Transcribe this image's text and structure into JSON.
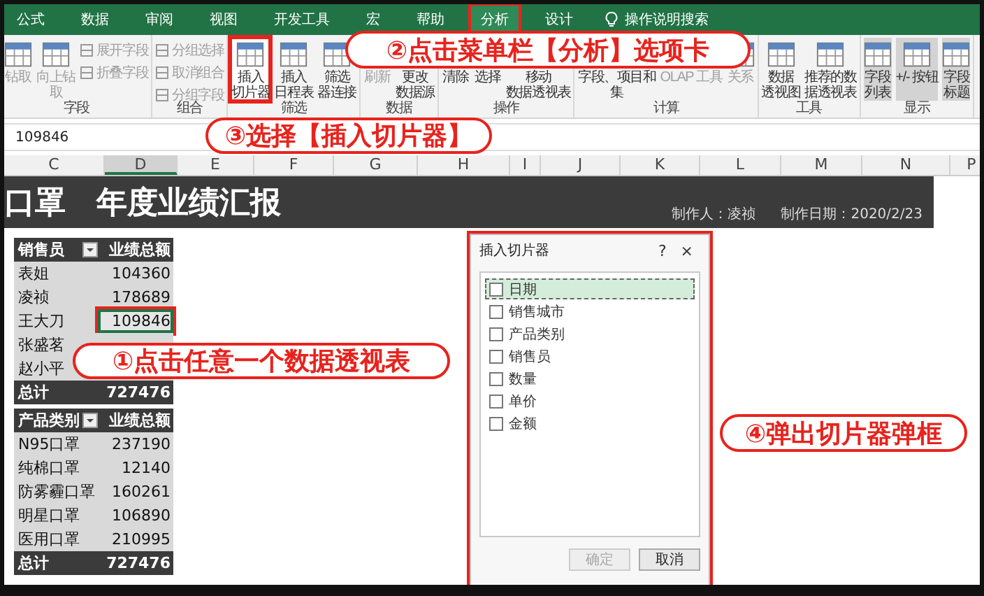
{
  "tabs": [
    {
      "label": "公式",
      "selected": false
    },
    {
      "label": "数据",
      "selected": false
    },
    {
      "label": "审阅",
      "selected": false
    },
    {
      "label": "视图",
      "selected": false
    },
    {
      "label": "开发工具",
      "selected": false
    },
    {
      "label": "宏",
      "selected": false
    },
    {
      "label": "帮助",
      "selected": false
    },
    {
      "label": "分析",
      "selected": true
    },
    {
      "label": "设计",
      "selected": false
    }
  ],
  "tell_me": "操作说明搜索",
  "ribbon_groups": [
    {
      "label": "字段",
      "large": [
        {
          "lines": [
            "钻取"
          ],
          "disabled": true,
          "selected": false,
          "highlighted": false
        },
        {
          "lines": [
            "向上钻",
            "取"
          ],
          "disabled": true,
          "selected": false,
          "highlighted": false
        }
      ],
      "small": [
        {
          "label": "展开字段",
          "disabled": true
        },
        {
          "label": "折叠字段",
          "disabled": true
        }
      ]
    },
    {
      "label": "组合",
      "small": [
        {
          "label": "分组选择",
          "disabled": true
        },
        {
          "label": "取消组合",
          "disabled": true
        },
        {
          "label": "分组字段",
          "disabled": true
        }
      ]
    },
    {
      "label": "筛选",
      "large": [
        {
          "lines": [
            "插入",
            "切片器"
          ],
          "disabled": false,
          "selected": false,
          "highlighted": true
        },
        {
          "lines": [
            "插入",
            "日程表"
          ],
          "disabled": false,
          "selected": false,
          "highlighted": false
        },
        {
          "lines": [
            "筛选",
            "器连接"
          ],
          "disabled": false,
          "selected": false,
          "highlighted": false
        }
      ]
    },
    {
      "label": "数据",
      "large": [
        {
          "lines": [
            "刷新"
          ],
          "disabled": true,
          "selected": false,
          "highlighted": false
        },
        {
          "lines": [
            "更改",
            "数据源"
          ],
          "disabled": false,
          "selected": false,
          "highlighted": false
        }
      ]
    },
    {
      "label": "操作",
      "large": [
        {
          "lines": [
            "清除"
          ],
          "disabled": false,
          "selected": false,
          "highlighted": false
        },
        {
          "lines": [
            "选择"
          ],
          "disabled": false,
          "selected": false,
          "highlighted": false
        },
        {
          "lines": [
            "移动",
            "数据透视表"
          ],
          "disabled": false,
          "selected": false,
          "highlighted": false
        }
      ]
    },
    {
      "label": "计算",
      "large": [
        {
          "lines": [
            "字段、项目和",
            "集"
          ],
          "disabled": false,
          "selected": false,
          "highlighted": false
        },
        {
          "lines": [
            "OLAP 工具"
          ],
          "disabled": true,
          "selected": false,
          "highlighted": false
        },
        {
          "lines": [
            "关系"
          ],
          "disabled": true,
          "selected": false,
          "highlighted": false
        }
      ]
    },
    {
      "label": "工具",
      "large": [
        {
          "lines": [
            "数据",
            "透视图"
          ],
          "disabled": false,
          "selected": false,
          "highlighted": false
        },
        {
          "lines": [
            "推荐的数",
            "据透视表"
          ],
          "disabled": false,
          "selected": false,
          "highlighted": false
        }
      ]
    },
    {
      "label": "显示",
      "large": [
        {
          "lines": [
            "字段",
            "列表"
          ],
          "disabled": false,
          "selected": true,
          "highlighted": false
        },
        {
          "lines": [
            "+/- 按钮"
          ],
          "disabled": false,
          "selected": true,
          "highlighted": false
        },
        {
          "lines": [
            "字段",
            "标题"
          ],
          "disabled": false,
          "selected": true,
          "highlighted": false
        }
      ]
    }
  ],
  "formula_bar": {
    "value": "109846"
  },
  "columns": [
    {
      "label": "C",
      "selected": false
    },
    {
      "label": "D",
      "selected": true
    },
    {
      "label": "E",
      "selected": false
    },
    {
      "label": "F",
      "selected": false
    },
    {
      "label": "G",
      "selected": false
    },
    {
      "label": "H",
      "selected": false
    },
    {
      "label": "I",
      "selected": false
    },
    {
      "label": "J",
      "selected": false
    },
    {
      "label": "K",
      "selected": false
    },
    {
      "label": "L",
      "selected": false
    },
    {
      "label": "M",
      "selected": false
    },
    {
      "label": "N",
      "selected": false
    },
    {
      "label": "P",
      "selected": false
    }
  ],
  "report": {
    "title": "口罩　年度业绩汇报",
    "author": "制作人：凌祯",
    "date": "制作日期：2020/2/23"
  },
  "pivot_tables": [
    {
      "row_header": "销售员",
      "value_header": "业绩总额",
      "rows": [
        {
          "label": "表姐",
          "value": "104360",
          "selected": false
        },
        {
          "label": "凌祯",
          "value": "178689",
          "selected": false
        },
        {
          "label": "王大刀",
          "value": "109846",
          "selected": true
        },
        {
          "label": "张盛茗",
          "selected": false
        },
        {
          "label": "赵小平",
          "selected": false
        }
      ],
      "total_label": "总计",
      "total": "727476"
    },
    {
      "row_header": "产品类别",
      "value_header": "业绩总额",
      "rows": [
        {
          "label": "N95口罩",
          "value": "237190",
          "selected": false
        },
        {
          "label": "纯棉口罩",
          "value": "12140",
          "selected": false
        },
        {
          "label": "防雾霾口罩",
          "value": "160261",
          "selected": false
        },
        {
          "label": "明星口罩",
          "value": "106890",
          "selected": false
        },
        {
          "label": "医用口罩",
          "value": "210995",
          "selected": false
        }
      ],
      "total_label": "总计",
      "total": "727476"
    }
  ],
  "dialog": {
    "title": "插入切片器",
    "help": "?",
    "close": "×",
    "fields": [
      {
        "label": "日期",
        "checked": false,
        "selected": true
      },
      {
        "label": "销售城市",
        "checked": false,
        "selected": false
      },
      {
        "label": "产品类别",
        "checked": false,
        "selected": false
      },
      {
        "label": "销售员",
        "checked": false,
        "selected": false
      },
      {
        "label": "数量",
        "checked": false,
        "selected": false
      },
      {
        "label": "单价",
        "checked": false,
        "selected": false
      },
      {
        "label": "金额",
        "checked": false,
        "selected": false
      }
    ],
    "buttons": [
      {
        "label": "确定",
        "disabled": true
      },
      {
        "label": "取消",
        "disabled": false
      }
    ]
  },
  "annotations": [
    "②点击菜单栏【分析】选项卡",
    "③选择【插入切片器】",
    "①点击任意一个数据透视表",
    "④弹出切片器弹框"
  ]
}
